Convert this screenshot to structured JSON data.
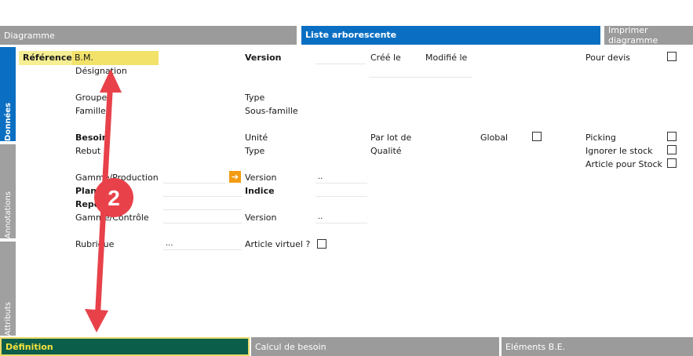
{
  "top_tabs": {
    "diagramme": "Diagramme",
    "liste": "Liste arborescente",
    "imprimer": "Imprimer diagramme"
  },
  "side_tabs": {
    "donnees": "Données",
    "annotations": "Annotations",
    "attributs": "Attributs"
  },
  "form": {
    "reference_label": "Référence",
    "reference_value": "B.M.",
    "designation": "Désignation",
    "version": "Version",
    "cree_le": "Créé le",
    "modifie_le": "Modifié le",
    "pour_devis": "Pour devis",
    "groupe": "Groupe",
    "famille": "Famille",
    "type": "Type",
    "sous_famille": "Sous-famille",
    "besoin": "Besoin",
    "rebut": "Rebut",
    "unite": "Unité",
    "type2": "Type",
    "par_lot_de": "Par lot de",
    "qualite": "Qualité",
    "global": "Global",
    "picking": "Picking",
    "ignorer_stock": "Ignorer le stock",
    "article_pour_stock": "Article pour Stock",
    "gamme_production": "Gamme/Production",
    "version2": "Version",
    "version2_value": "..",
    "plan": "Plan",
    "indice": "Indice",
    "repere": "Repère",
    "gamme_controle": "Gamme/Contrôle",
    "version3": "Version",
    "version3_value": "..",
    "rubrique": "Rubrique",
    "rubrique_value": "...",
    "article_virtuel": "Article virtuel ?"
  },
  "annotation": {
    "badge_number": "2",
    "arrow_color": "#e8414a"
  },
  "bottom_tabs": {
    "definition": "Définition",
    "calcul": "Calcul de besoin",
    "elements": "Eléments B.E."
  },
  "colors": {
    "accent_blue": "#0a6fc2",
    "tab_gray": "#9b9b9b",
    "active_green": "#0b5e4a",
    "active_yellow": "#f6e33d",
    "highlight_yellow": "#f2e26a"
  }
}
